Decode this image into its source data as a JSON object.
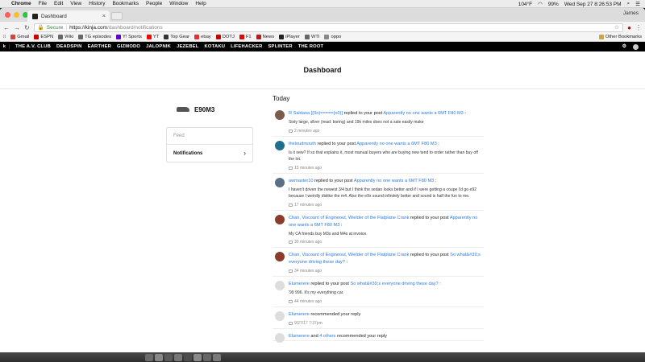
{
  "menubar": {
    "app": "Chrome",
    "items": [
      "File",
      "Edit",
      "View",
      "History",
      "Bookmarks",
      "People",
      "Window",
      "Help"
    ],
    "status": {
      "temperature": "104°F",
      "battery": "99%",
      "clock": "Wed Sep 27  8:26:53 PM"
    }
  },
  "browser": {
    "tab_title": "Dashboard",
    "profile_name": "James",
    "secure_label": "Secure",
    "url_scheme_host": "https://kinja.com",
    "url_path": "/dashboard/notifications"
  },
  "bookmarks": [
    {
      "label": "Gmail",
      "color": "#d44638"
    },
    {
      "label": "ESPN",
      "color": "#cc0000"
    },
    {
      "label": "Wiki",
      "color": "#666666"
    },
    {
      "label": "TG episodes",
      "color": "#666666"
    },
    {
      "label": "Y! Sports",
      "color": "#5f01d1"
    },
    {
      "label": "YT",
      "color": "#ff0000"
    },
    {
      "label": "Top Gear",
      "color": "#333333"
    },
    {
      "label": "ebay",
      "color": "#e53238"
    },
    {
      "label": "DOTJ",
      "color": "#cc0000"
    },
    {
      "label": "F1",
      "color": "#e10600"
    },
    {
      "label": "News",
      "color": "#bb1919"
    },
    {
      "label": "iPlayer",
      "color": "#222222"
    },
    {
      "label": "WTI",
      "color": "#666666"
    },
    {
      "label": "oppo",
      "color": "#888888"
    }
  ],
  "bookmarks_other": "Other Bookmarks",
  "sitenav": {
    "items": [
      "THE A.V. CLUB",
      "DEADSPIN",
      "EARTHER",
      "GIZMODO",
      "JALOPNIK",
      "JEZEBEL",
      "KOTAKU",
      "LIFEHACKER",
      "SPLINTER",
      "THE ROOT"
    ]
  },
  "page_title": "Dashboard",
  "user": {
    "name": "E90M3"
  },
  "menu": {
    "feed": "Feed",
    "notifications": "Notifications"
  },
  "feed": {
    "heading": "Today",
    "items": [
      {
        "user": "R Saldana [(0o)=====(o0)]",
        "action": " replied to your post ",
        "post": "Apparently no one wants a 6MT F80 M3",
        "tail": " :",
        "body": "Sixty large, silver (read: boring) and 19k miles does not a sale easily make",
        "time": "2 minutes ago",
        "avatar": "#7a5a48"
      },
      {
        "user": "theloudmouth",
        "action": " replied to your post ",
        "post": "Apparently no one wants a 6MT F80 M3",
        "tail": " :",
        "body": "Is it new? If so that explains it, most manual buyers who are buying new tend to order rather than buy off the lot.",
        "time": "15 minutes ago",
        "avatar": "#1f6e8c"
      },
      {
        "user": "awmaster10",
        "action": " replied to your post ",
        "post": "Apparently no one wants a 6MT F80 M3",
        "tail": " :",
        "body": "I haven't driven the newest 3/4 but I think the sedan looks better and if I were getting a coupe I'd go e92 because I weirdly dislike the m4. Also the e9x sound infinitely better and sound is half the fun to me.",
        "time": "17 minutes ago",
        "avatar": "#5b6f86"
      },
      {
        "user": "Chan, Viscount of Engineout, Wielder of the Flatplane Crank",
        "action": " replied to your post ",
        "post": "Apparently no one wants a 6MT F80 M3",
        "tail": " :",
        "body": "My CA friends buy M3s and M4s at invoice.",
        "time": "30 minutes ago",
        "avatar": "#8a3b2e"
      },
      {
        "user": "Chan, Viscount of Engineout, Wielder of the Flatplane Crank",
        "action": " replied to your post ",
        "post": "So what&#39;s everyone driving these day?",
        "tail": " :",
        "body": "",
        "time": "34 minutes ago",
        "avatar": "#8a3b2e"
      },
      {
        "user": "Elumerere",
        "action": " replied to your post ",
        "post": "So what&#39;s everyone driving these day?",
        "tail": " :",
        "body": "'99 996. It's my everything car.",
        "time": "44 minutes ago",
        "avatar": "#dddddd"
      },
      {
        "user": "Elumerere",
        "action": " recommended your reply",
        "post": "",
        "tail": "",
        "body": "",
        "time": "9/27/17 7:37pm",
        "avatar": "#dddddd"
      },
      {
        "user": "Elumerere",
        "action": " and ",
        "post": "4 others",
        "tail": " recommended your reply",
        "body": "",
        "time": "",
        "avatar": "#dddddd"
      }
    ]
  }
}
